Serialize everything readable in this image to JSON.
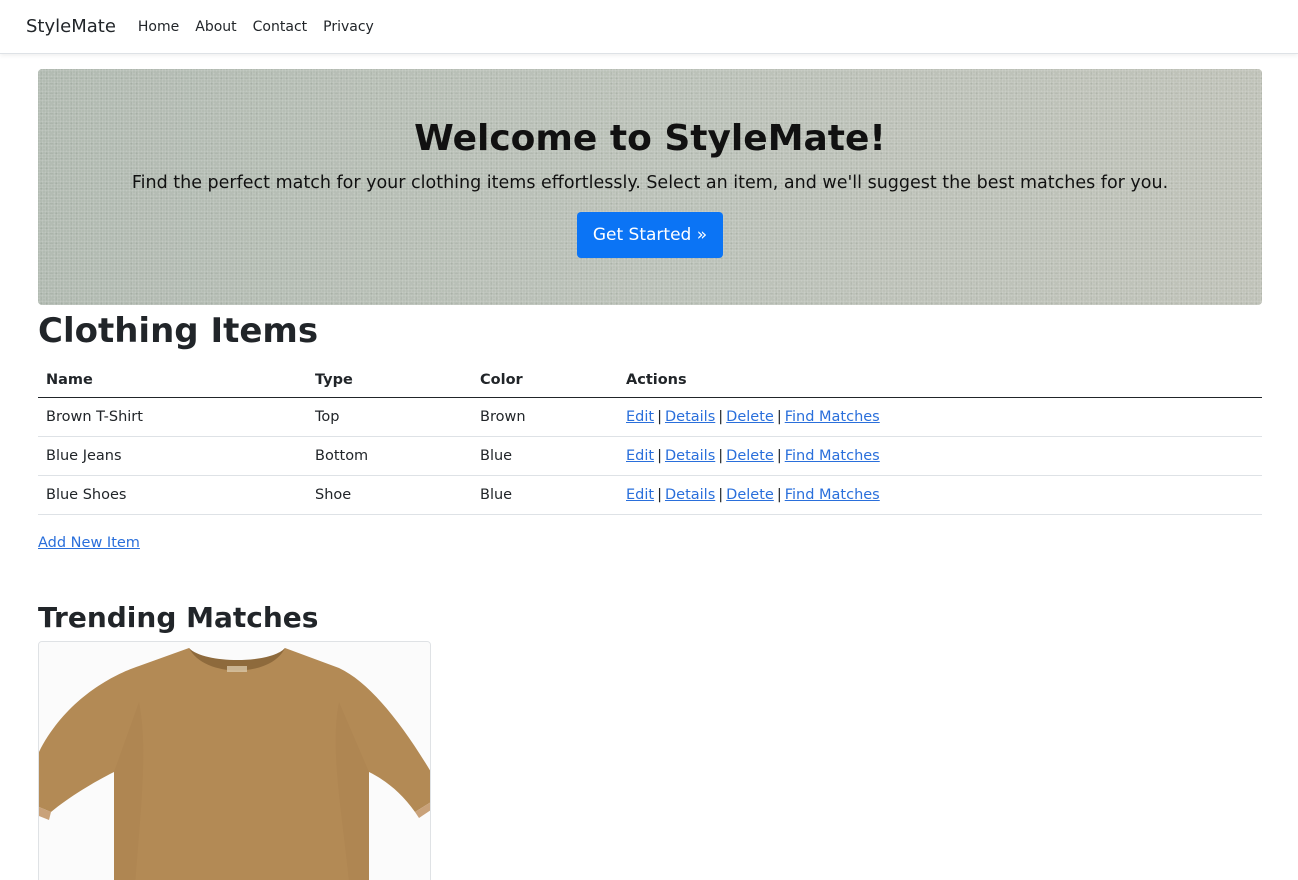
{
  "nav": {
    "brand": "StyleMate",
    "links": [
      "Home",
      "About",
      "Contact",
      "Privacy"
    ]
  },
  "hero": {
    "title": "Welcome to StyleMate!",
    "text": "Find the perfect match for your clothing items effortlessly. Select an item, and we'll suggest the best matches for you.",
    "button": "Get Started »"
  },
  "clothing": {
    "title": "Clothing Items",
    "headers": [
      "Name",
      "Type",
      "Color",
      "Actions"
    ],
    "rows": [
      {
        "name": "Brown T-Shirt",
        "type": "Top",
        "color": "Brown"
      },
      {
        "name": "Blue Jeans",
        "type": "Bottom",
        "color": "Blue"
      },
      {
        "name": "Blue Shoes",
        "type": "Shoe",
        "color": "Blue"
      }
    ],
    "actions": [
      "Edit",
      "Details",
      "Delete",
      "Find Matches"
    ],
    "separator": "|",
    "add_link": "Add New Item"
  },
  "trending": {
    "title": "Trending Matches",
    "image_icon": "brown-tshirt-image"
  },
  "colors": {
    "primary_button": "#0b74f5",
    "link": "#2a6fdb",
    "shirt": "#b38a55"
  }
}
